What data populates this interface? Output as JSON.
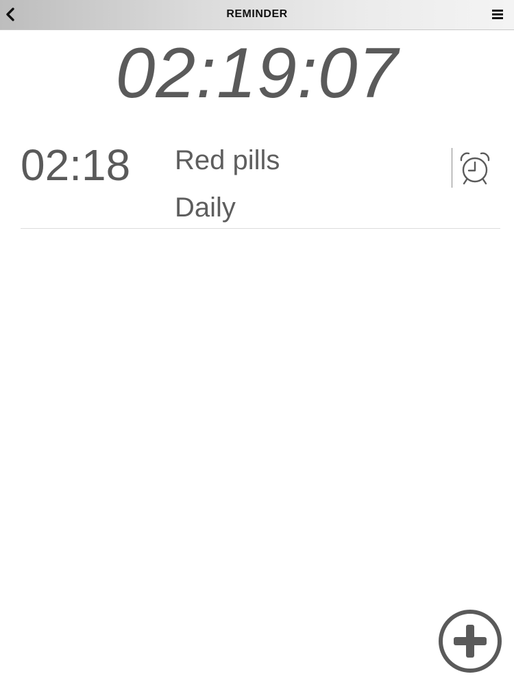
{
  "nav": {
    "title": "REMINDER",
    "back_icon": "chevron-left-icon",
    "menu_icon": "hamburger-menu-icon"
  },
  "clock": {
    "current_time": "02:19:07"
  },
  "reminders": [
    {
      "time": "02:18",
      "name": "Red pills",
      "frequency": "Daily",
      "icon": "alarm-clock-icon"
    }
  ],
  "add_button": {
    "icon": "plus-circle-icon"
  },
  "colors": {
    "text": "#5a5a5a",
    "nav_gradient_start": "#bdbdbd",
    "nav_gradient_end": "#f4f4f4",
    "title": "#111111",
    "divider": "#dcdcdc"
  }
}
